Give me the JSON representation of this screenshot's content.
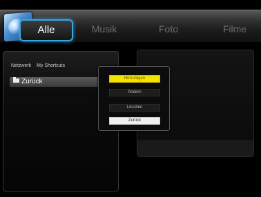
{
  "tabs": [
    {
      "label": "Alle",
      "active": true
    },
    {
      "label": "Musik",
      "active": false
    },
    {
      "label": "Foto",
      "active": false
    },
    {
      "label": "Filme",
      "active": false
    }
  ],
  "subnav": [
    "Netzwerk",
    "My Shortcuts"
  ],
  "folder_row": {
    "label": "Zurück",
    "icon": "folder-icon"
  },
  "popup": {
    "items": [
      {
        "label": "Hinzufügen",
        "style": "yellow"
      },
      {
        "label": "Ändern",
        "style": "dark"
      },
      {
        "label": "Löschen",
        "style": "dark"
      },
      {
        "label": "Zurück",
        "style": "white"
      }
    ]
  },
  "colors": {
    "accent": "#3aa7e0",
    "highlight": "#f3e300",
    "background": "#000000"
  }
}
